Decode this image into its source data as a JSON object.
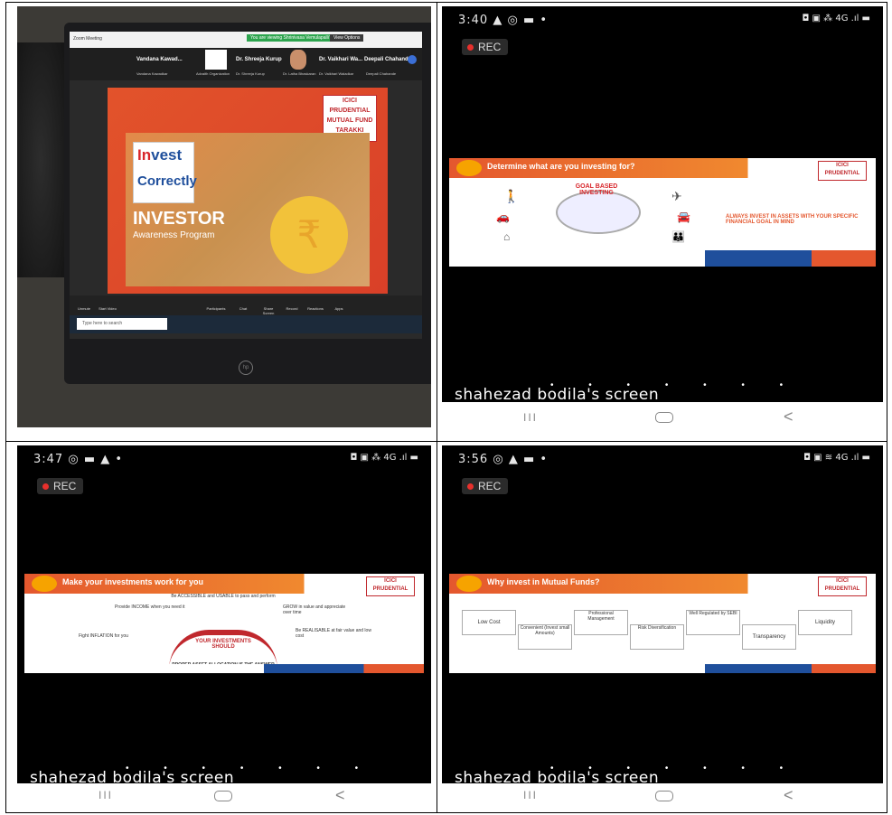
{
  "photo": {
    "meeting_window_title": "Zoom Meeting",
    "banner": "You are viewing Shrinivasa Vemulapalli's screen",
    "view_options": "View Options",
    "participants": [
      {
        "name": "Vandana Kawad...",
        "sub": "Vandana Kawadkar"
      },
      {
        "name": "",
        "sub": "Advaith Organization"
      },
      {
        "name": "Dr. Shreeja Kurup",
        "sub": "Dr. Shreeja Kurup"
      },
      {
        "name": "",
        "sub": "Dr. Latha Bhaskaran"
      },
      {
        "name": "Dr. Vaikhari Wa...",
        "sub": "Dr. Vaikhari Waladkar"
      },
      {
        "name": "Deepali Chahande",
        "sub": "Deepali Chahande"
      }
    ],
    "slide": {
      "invest_word_a": "In",
      "invest_word_b": "vest",
      "correctly": "Correctly",
      "investor": "INVESTOR",
      "awareness": "Awareness Program",
      "rupee": "₹",
      "icici_lines": [
        "ICICI",
        "PRUDENTIAL",
        "MUTUAL FUND",
        "TARAKKI KAREIN!"
      ]
    },
    "tools": [
      "Unmute",
      "Start Video",
      "Participants",
      "Chat",
      "Share Screen",
      "Record",
      "Reactions",
      "Apps"
    ],
    "taskbar_search": "Type here to search",
    "hp_logo": "hp"
  },
  "screens": [
    {
      "time": "3:40",
      "status_icons": "▲ ◎ ▬ •",
      "status_right": "◘ ▣ ⁂ 4G .ıl ▬",
      "rec_label": "REC",
      "slide_title": "Determine what are you investing for?",
      "slide_heading": "GOAL BASED INVESTING",
      "slide_note": "ALWAYS INVEST IN ASSETS WITH YOUR SPECIFIC FINANCIAL GOAL IN MIND",
      "screen_label": "shahezad bodila's screen"
    },
    {
      "time": "3:47",
      "status_icons": "◎ ▬ ▲ •",
      "status_right": "◘ ▣ ⁂ 4G .ıl ▬",
      "rec_label": "REC",
      "slide_title": "Make your investments work for you",
      "slide_center": "YOUR INVESTMENTS SHOULD",
      "slide_points": [
        "Be ACCESSIBLE and USABLE to pass and perform",
        "Provide INCOME when you need it",
        "GROW in value and appreciate over time",
        "Fight INFLATION for you",
        "Be REALISABLE at fair value and low cost"
      ],
      "slide_footer": "PROPER ASSET ALLOCATION IS THE ANSWER",
      "screen_label": "shahezad bodila's screen"
    },
    {
      "time": "3:56",
      "status_icons": "◎ ▲ ▬ •",
      "status_right": "◘ ▣ ≋ 4G .ıl ▬",
      "rec_label": "REC",
      "slide_title": "Why invest in Mutual Funds?",
      "slide_points": [
        "Low Cost",
        "Convenient (Invest small Amounts)",
        "Professional Management",
        "Risk Diversification",
        "Well Regulated by SEBI",
        "Transparency",
        "Liquidity"
      ],
      "screen_label": "shahezad bodila's screen"
    }
  ],
  "nav": {
    "recents": "III",
    "back": "<"
  },
  "colors": {
    "orange": "#e4572e",
    "blue": "#1f4f9c",
    "red": "#c0282d",
    "rec_red": "#e8302c"
  }
}
